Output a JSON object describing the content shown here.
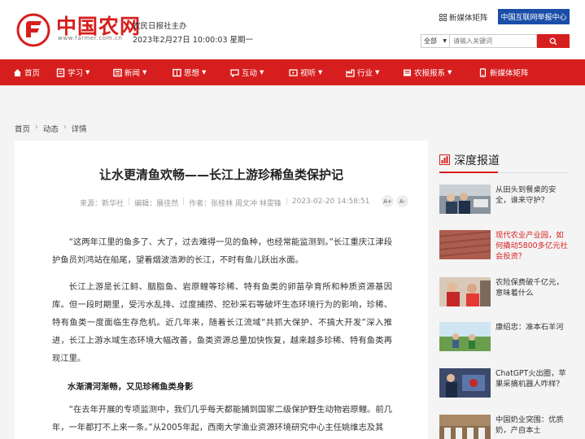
{
  "header": {
    "logo_text": "中国农网",
    "logo_url": "www.farmer.com.cn",
    "sponsor": "农民日报社主办",
    "datetime": "2023年2月27日 10:00:03 星期一",
    "media_link": "新媒体矩阵",
    "report_button": "中国互联网举报中心",
    "search": {
      "scope": "全部",
      "placeholder": "请输入关键词"
    }
  },
  "nav": {
    "items": [
      {
        "label": "首页",
        "icon": "home-icon",
        "has_caret": false
      },
      {
        "label": "学习",
        "icon": "book-icon",
        "has_caret": true
      },
      {
        "label": "新闻",
        "icon": "news-icon",
        "has_caret": true
      },
      {
        "label": "思想",
        "icon": "idea-icon",
        "has_caret": true
      },
      {
        "label": "互动",
        "icon": "chat-icon",
        "has_caret": true
      },
      {
        "label": "视听",
        "icon": "video-icon",
        "has_caret": true
      },
      {
        "label": "行业",
        "icon": "industry-icon",
        "has_caret": true
      },
      {
        "label": "农报报系",
        "icon": "newspaper-icon",
        "has_caret": true
      },
      {
        "label": "新媒体矩阵",
        "icon": "mobile-icon",
        "has_caret": false
      }
    ]
  },
  "breadcrumb": {
    "home": "首页",
    "section": "动态",
    "current": "详情",
    "separator": "›"
  },
  "article": {
    "title": "让水更清鱼欢畅——长江上游珍稀鱼类保护记",
    "source": "来源：新华社",
    "editor": "编辑：展佳然",
    "author": "作者：张桂林 周文冲 林雯锋",
    "time": "2023-02-20 14:58:51",
    "font_larger": "A+",
    "font_smaller": "A-",
    "para1": "“这两年江里的鱼多了、大了，过去难得一见的鱼种，也经常能监测到。”长江重庆江津段护鱼员刘鸿站在船尾，望着烟波浩渺的长江，不时有鱼儿跃出水面。",
    "para2": "长江上游是长江鲟、胭脂鱼、岩原鲤等珍稀、特有鱼类的卵苗孕育所和种质资源基因库。但一段时期里，受污水乱排、过度捕捞、挖砂采石等破坏生态环境行为的影响，珍稀、特有鱼类一度面临生存危机。近几年来，随着长江流域“共抓大保护、不搞大开发”深入推进，长江上游水域生态环境大幅改善，鱼类资源总量加快恢复，越来越多珍稀、特有鱼类再现江里。",
    "subhead": "水渐清河渐畅，又见珍稀鱼类身影",
    "para3": "“在去年开展的专项监测中，我们几乎每天都能捕到国家二级保护野生动物岩原鲤。前几年，一年都打不上来一条。”从2005年起，西南大学渔业资源环境研究中心主任姚维志及其"
  },
  "sidebar": {
    "title": "深度报道",
    "items": [
      {
        "text": "从田头到餐桌的安全，谁来守护？",
        "highlight": false
      },
      {
        "text": "现代农业产业园，如何撬动5800多亿元社会投资？",
        "highlight": true
      },
      {
        "text": "农险保费破千亿元，意味着什么",
        "highlight": false
      },
      {
        "text": "康绍忠：准本石羊河",
        "highlight": false
      },
      {
        "text": "ChatGPT火出圈，苹果采摘机器人咋样？",
        "highlight": false
      },
      {
        "text": "中国奶业突围：优质奶，产自本土",
        "highlight": false
      }
    ]
  },
  "colors": {
    "brand_red": "#d71e1e",
    "report_blue": "#1a4ea8"
  }
}
